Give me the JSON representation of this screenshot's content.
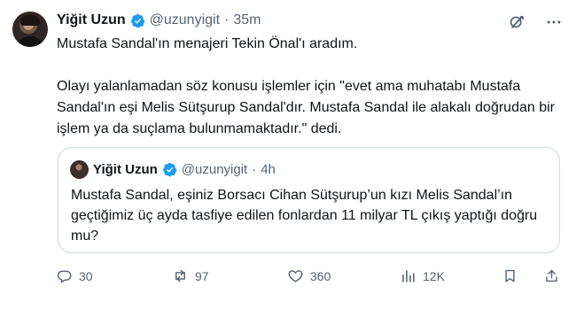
{
  "tweet": {
    "author": {
      "name": "Yiğit Uzun",
      "handle": "@uzunyigit",
      "separator": "·",
      "time": "35m"
    },
    "text": "Mustafa Sandal'ın menajeri Tekin Önal'ı aradım.\n\nOlayı yalanlamadan söz konusu işlemler için \"evet ama muhatabı Mustafa Sandal'ın eşi Melis Sütşurup Sandal'dır. Mustafa Sandal ile alakalı doğrudan bir işlem ya da suçlama bulunmamaktadır.\" dedi.",
    "top_icons": [
      "grok-icon",
      "more-icon"
    ]
  },
  "quote": {
    "author": {
      "name": "Yiğit Uzun",
      "handle": "@uzunyigit",
      "separator": "·",
      "time": "4h"
    },
    "text": "Mustafa Sandal, eşiniz Borsacı Cihan Sütşurup’un kızı Melis Sandal’ın geçtiğimiz üç ayda tasfiye edilen fonlardan 11 milyar TL çıkış yaptığı doğru mu?"
  },
  "actions": {
    "replies": "30",
    "reposts": "97",
    "likes": "360",
    "views": "12K",
    "icons": [
      "reply-icon",
      "repost-icon",
      "like-icon",
      "views-icon",
      "bookmark-icon",
      "share-icon"
    ]
  },
  "colors": {
    "verified": "#1d9bf0",
    "text": "#0f1419",
    "muted": "#536471",
    "border": "#cfd9de"
  }
}
